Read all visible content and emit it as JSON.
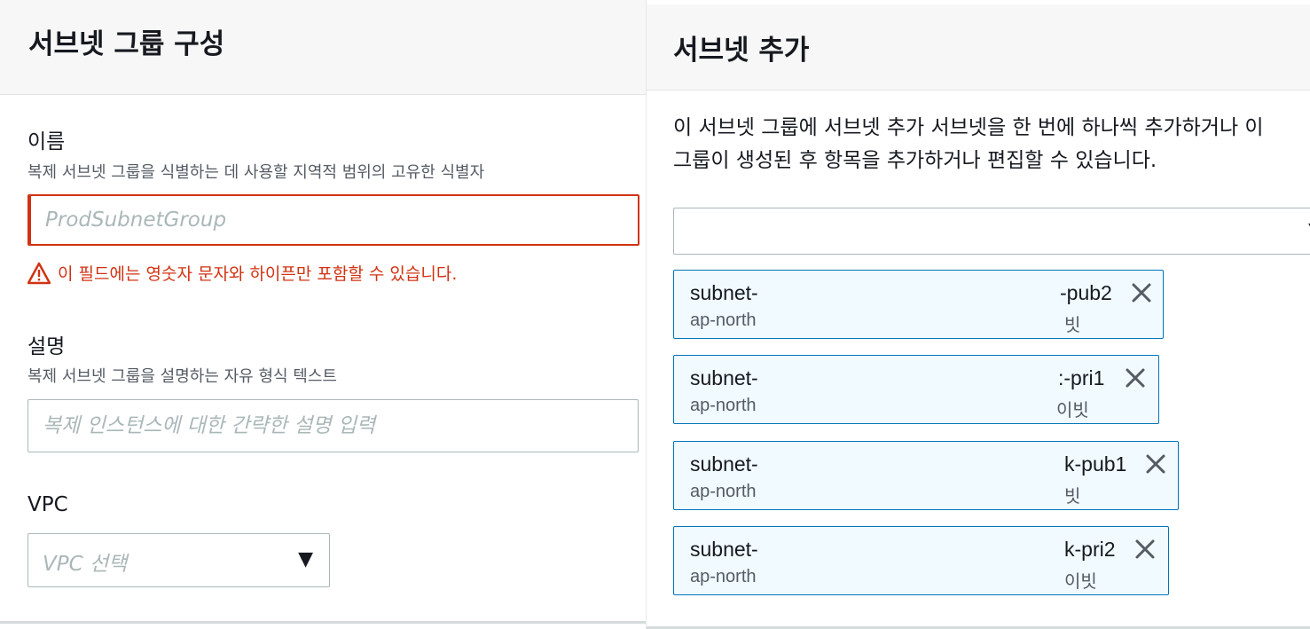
{
  "left": {
    "title": "서브넷 그룹 구성",
    "name_field": {
      "label": "이름",
      "description": "복제 서브넷 그룹을 식별하는 데 사용할 지역적 범위의 고유한 식별자",
      "placeholder": "ProdSubnetGroup",
      "error": "이 필드에는 영숫자 문자와 하이픈만 포함할 수 있습니다."
    },
    "desc_field": {
      "label": "설명",
      "description": "복제 서브넷 그룹을 설명하는 자유 형식 텍스트",
      "placeholder": "복제 인스턴스에 대한 간략한 설명 입력"
    },
    "vpc_field": {
      "label": "VPC",
      "placeholder": "VPC 선택",
      "caret": "▼"
    }
  },
  "right": {
    "title": "서브넷 추가",
    "help_line1": "이 서브넷 그룹에 서브넷 추가 서브넷을 한 번에 하나씩 추가하거나 이",
    "help_line2": "그룹이 생성된 후 항목을 추가하거나 편집할 수 있습니다.",
    "select_caret": "▼",
    "tokens": [
      {
        "name": "subnet-",
        "suffix": "-pub2",
        "sub": "ap-north",
        "sub_suffix": "빗"
      },
      {
        "name": "subnet-",
        "suffix": ":-pri1",
        "sub": "ap-north",
        "sub_suffix": "이빗"
      },
      {
        "name": "subnet-",
        "suffix": "k-pub1",
        "sub": "ap-north",
        "sub_suffix": "빗"
      },
      {
        "name": "subnet-",
        "suffix": "k-pri2",
        "sub": "ap-north",
        "sub_suffix": "이빗"
      }
    ]
  },
  "colors": {
    "error": "#d13212",
    "token_border": "#0073bb",
    "token_bg": "#f1faff",
    "header_bg": "#f7f7f7"
  }
}
